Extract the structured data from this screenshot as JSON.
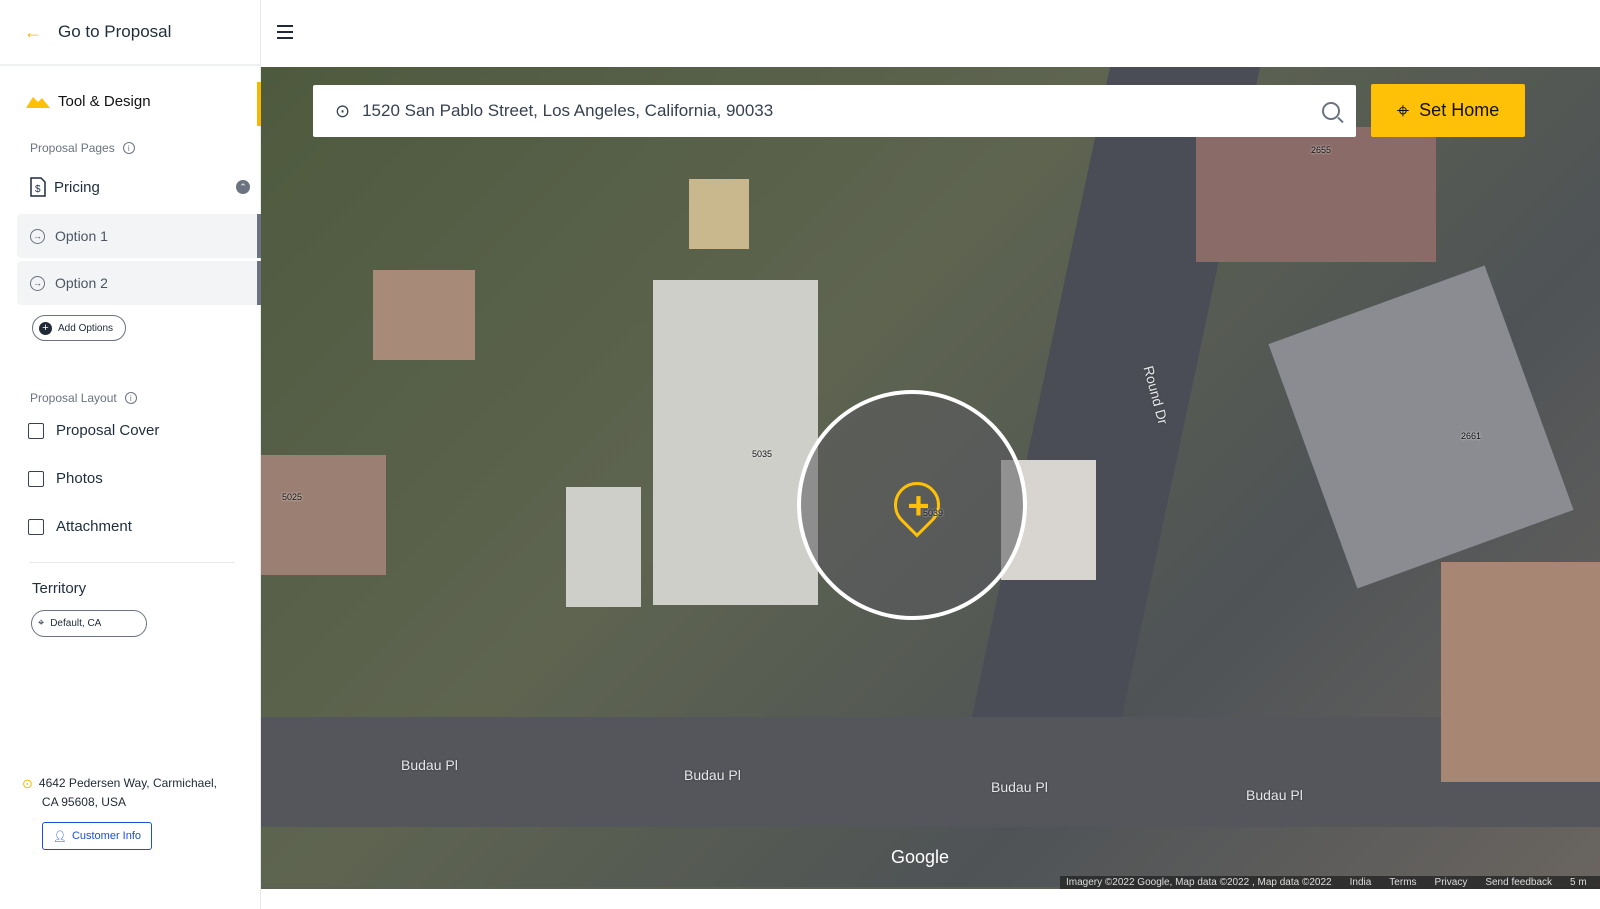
{
  "sidebar": {
    "back_label": "Go to Proposal",
    "section_title": "Tool & Design",
    "proposal_pages_label": "Proposal Pages",
    "pricing_label": "Pricing",
    "options": [
      {
        "label": "Option 1"
      },
      {
        "label": "Option 2"
      }
    ],
    "add_options_label": "Add Options",
    "proposal_layout_label": "Proposal Layout",
    "layout_items": [
      {
        "label": "Proposal Cover",
        "icon": "cover-icon"
      },
      {
        "label": "Photos",
        "icon": "photos-icon"
      },
      {
        "label": "Attachment",
        "icon": "attachment-icon"
      }
    ],
    "territory_label": "Territory",
    "territory_value": "Default, CA",
    "address_line1": "4642 Pedersen Way, Carmichael,",
    "address_line2": "CA 95608, USA",
    "customer_info_label": "Customer Info"
  },
  "map": {
    "search_value": "1520 San Pablo Street, Los Angeles, California, 90033",
    "set_home_label": "Set Home",
    "road_labels": [
      "Budau Pl",
      "Budau Pl",
      "Budau Pl",
      "Budau Pl",
      "Round Dr"
    ],
    "parcel_labels": [
      "2655",
      "5035",
      "5025",
      "2661",
      "5039"
    ],
    "google_logo": "Google",
    "footer": {
      "attribution": "Imagery ©2022 Google, Map data ©2022 , Map data ©2022",
      "region": "India",
      "terms": "Terms",
      "privacy": "Privacy",
      "feedback": "Send feedback",
      "scale": "5 m"
    }
  },
  "colors": {
    "accent": "#ffc107",
    "link": "#1d4ed8"
  }
}
